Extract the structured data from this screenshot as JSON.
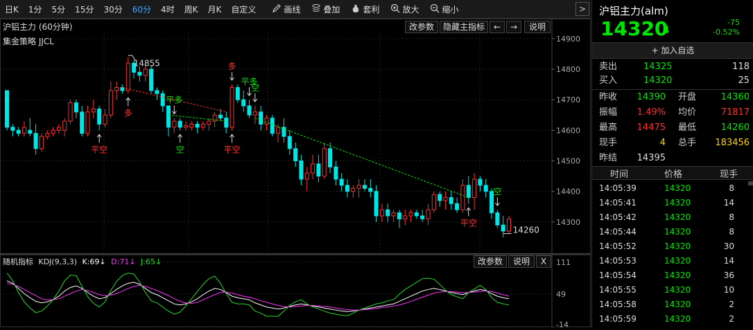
{
  "toolbar": {
    "periods": [
      {
        "label": "日K"
      },
      {
        "label": "1分"
      },
      {
        "label": "5分"
      },
      {
        "label": "15分"
      },
      {
        "label": "30分"
      },
      {
        "label": "60分",
        "active": true
      },
      {
        "label": "4时"
      },
      {
        "label": "周K"
      },
      {
        "label": "月K"
      },
      {
        "label": "自定义"
      }
    ],
    "tools": [
      {
        "label": "画线",
        "icon": "pencil-icon"
      },
      {
        "label": "叠加",
        "icon": "layers-icon"
      },
      {
        "label": "套利",
        "icon": "money-bag-icon"
      },
      {
        "label": "放大",
        "icon": "zoom-in-icon"
      },
      {
        "label": "缩小",
        "icon": "zoom-out-icon"
      }
    ],
    "nav_arrow": ">"
  },
  "main_panel": {
    "title": "沪铝主力 (60分钟)",
    "strategy": "集金策略  JJCL",
    "buttons": {
      "params": "改参数",
      "hide": "隐藏主指标",
      "left": "←",
      "right": "→",
      "help": "说明"
    },
    "y_ticks": [
      14900,
      14800,
      14700,
      14600,
      14500,
      14400,
      14300
    ],
    "high_label": "14855",
    "low_label": "14260"
  },
  "sub_panel": {
    "title": "随机指标",
    "kdj_name": "KDJ(9,3,3)",
    "k": "K:69↓",
    "d": "D:71↓",
    "j": "J:65↓",
    "buttons": {
      "params": "改参数",
      "help": "说明",
      "close": "X"
    },
    "y_ticks": [
      "111",
      "49",
      "-14"
    ]
  },
  "chart_data": {
    "type": "candlestick",
    "ylim": [
      14200,
      14920
    ],
    "y_ticks": [
      14900,
      14800,
      14700,
      14600,
      14500,
      14400,
      14300
    ],
    "candles": [
      [
        14730,
        14730,
        14600,
        14610
      ],
      [
        14610,
        14620,
        14580,
        14600
      ],
      [
        14600,
        14610,
        14580,
        14590
      ],
      [
        14590,
        14630,
        14580,
        14610
      ],
      [
        14600,
        14640,
        14580,
        14590
      ],
      [
        14590,
        14620,
        14520,
        14540
      ],
      [
        14540,
        14590,
        14530,
        14580
      ],
      [
        14580,
        14600,
        14570,
        14590
      ],
      [
        14590,
        14610,
        14580,
        14600
      ],
      [
        14600,
        14620,
        14590,
        14610
      ],
      [
        14600,
        14640,
        14580,
        14630
      ],
      [
        14630,
        14700,
        14620,
        14690
      ],
      [
        14690,
        14700,
        14640,
        14660
      ],
      [
        14660,
        14680,
        14580,
        14590
      ],
      [
        14590,
        14680,
        14580,
        14660
      ],
      [
        14660,
        14700,
        14640,
        14670
      ],
      [
        14670,
        14680,
        14600,
        14620
      ],
      [
        14620,
        14670,
        14610,
        14650
      ],
      [
        14650,
        14760,
        14640,
        14730
      ],
      [
        14730,
        14760,
        14700,
        14740
      ],
      [
        14740,
        14750,
        14720,
        14730
      ],
      [
        14730,
        14840,
        14720,
        14820
      ],
      [
        14820,
        14830,
        14770,
        14790
      ],
      [
        14790,
        14810,
        14760,
        14780
      ],
      [
        14780,
        14820,
        14760,
        14800
      ],
      [
        14800,
        14810,
        14720,
        14730
      ],
      [
        14730,
        14740,
        14700,
        14720
      ],
      [
        14720,
        14730,
        14660,
        14680
      ],
      [
        14680,
        14680,
        14580,
        14610
      ],
      [
        14610,
        14640,
        14590,
        14630
      ],
      [
        14630,
        14640,
        14600,
        14610
      ],
      [
        14610,
        14630,
        14600,
        14615
      ],
      [
        14610,
        14630,
        14600,
        14620
      ],
      [
        14620,
        14630,
        14590,
        14610
      ],
      [
        14610,
        14630,
        14600,
        14620
      ],
      [
        14620,
        14640,
        14600,
        14630
      ],
      [
        14630,
        14660,
        14610,
        14650
      ],
      [
        14650,
        14670,
        14630,
        14640
      ],
      [
        14640,
        14660,
        14590,
        14610
      ],
      [
        14610,
        14750,
        14600,
        14740
      ],
      [
        14740,
        14750,
        14690,
        14700
      ],
      [
        14700,
        14730,
        14660,
        14680
      ],
      [
        14680,
        14700,
        14640,
        14650
      ],
      [
        14650,
        14680,
        14620,
        14660
      ],
      [
        14660,
        14680,
        14600,
        14620
      ],
      [
        14620,
        14650,
        14600,
        14640
      ],
      [
        14640,
        14650,
        14580,
        14590
      ],
      [
        14590,
        14620,
        14560,
        14610
      ],
      [
        14610,
        14640,
        14560,
        14580
      ],
      [
        14580,
        14600,
        14520,
        14540
      ],
      [
        14540,
        14560,
        14480,
        14500
      ],
      [
        14500,
        14520,
        14420,
        14440
      ],
      [
        14440,
        14480,
        14400,
        14460
      ],
      [
        14460,
        14520,
        14440,
        14490
      ],
      [
        14490,
        14520,
        14430,
        14450
      ],
      [
        14450,
        14560,
        14440,
        14540
      ],
      [
        14540,
        14560,
        14460,
        14480
      ],
      [
        14480,
        14500,
        14420,
        14440
      ],
      [
        14440,
        14460,
        14400,
        14420
      ],
      [
        14420,
        14440,
        14380,
        14400
      ],
      [
        14400,
        14420,
        14380,
        14410
      ],
      [
        14410,
        14440,
        14380,
        14420
      ],
      [
        14420,
        14440,
        14400,
        14410
      ],
      [
        14410,
        14440,
        14380,
        14400
      ],
      [
        14400,
        14420,
        14300,
        14320
      ],
      [
        14320,
        14360,
        14300,
        14340
      ],
      [
        14340,
        14360,
        14300,
        14320
      ],
      [
        14320,
        14340,
        14300,
        14330
      ],
      [
        14330,
        14340,
        14280,
        14310
      ],
      [
        14310,
        14340,
        14290,
        14320
      ],
      [
        14320,
        14340,
        14300,
        14330
      ],
      [
        14330,
        14340,
        14310,
        14320
      ],
      [
        14320,
        14340,
        14300,
        14310
      ],
      [
        14310,
        14360,
        14290,
        14340
      ],
      [
        14340,
        14400,
        14330,
        14390
      ],
      [
        14390,
        14400,
        14350,
        14370
      ],
      [
        14370,
        14400,
        14340,
        14380
      ],
      [
        14380,
        14400,
        14340,
        14360
      ],
      [
        14360,
        14380,
        14330,
        14340
      ],
      [
        14340,
        14440,
        14330,
        14420
      ],
      [
        14420,
        14450,
        14360,
        14380
      ],
      [
        14380,
        14460,
        14340,
        14440
      ],
      [
        14440,
        14450,
        14400,
        14420
      ],
      [
        14420,
        14440,
        14380,
        14400
      ],
      [
        14400,
        14410,
        14310,
        14330
      ],
      [
        14330,
        14340,
        14280,
        14290
      ],
      [
        14290,
        14320,
        14250,
        14270
      ],
      [
        14270,
        14320,
        14260,
        14310
      ]
    ],
    "annotations": [
      {
        "text": "平空",
        "i": 16,
        "side": "below",
        "color": "#ff3030"
      },
      {
        "text": "多",
        "i": 21,
        "side": "below",
        "color": "#ff3030"
      },
      {
        "text": "平多",
        "i": 29,
        "side": "above",
        "color": "#00e600"
      },
      {
        "text": "空",
        "i": 30,
        "side": "below",
        "color": "#00e600"
      },
      {
        "text": "平空",
        "i": 39,
        "side": "below",
        "color": "#ff3030"
      },
      {
        "text": "多",
        "i": 39,
        "side": "above",
        "color": "#ff3030"
      },
      {
        "text": "平多",
        "i": 42,
        "side": "above",
        "color": "#00e600"
      },
      {
        "text": "空",
        "i": 43,
        "side": "above",
        "color": "#00e600"
      },
      {
        "text": "平空",
        "i": 80,
        "side": "below",
        "color": "#ff3030"
      },
      {
        "text": "空",
        "i": 85,
        "side": "above",
        "color": "#00e600"
      }
    ],
    "kdj": {
      "ylim": [
        -14,
        111
      ],
      "series": [
        {
          "name": "K",
          "color": "#ffffff",
          "values": [
            75,
            70,
            60,
            50,
            42,
            35,
            32,
            34,
            38,
            45,
            55,
            62,
            65,
            60,
            52,
            45,
            40,
            42,
            50,
            58,
            65,
            70,
            72,
            68,
            60,
            52,
            48,
            42,
            36,
            30,
            28,
            30,
            34,
            40,
            48,
            55,
            60,
            58,
            52,
            45,
            42,
            40,
            38,
            32,
            28,
            24,
            22,
            20,
            22,
            25,
            28,
            30,
            28,
            26,
            24,
            22,
            20,
            18,
            16,
            15,
            16,
            18,
            20,
            22,
            24,
            26,
            28,
            30,
            35,
            40,
            45,
            50,
            55,
            58,
            60,
            58,
            55,
            52,
            50,
            48,
            52,
            55,
            58,
            56,
            50,
            45,
            42,
            40
          ]
        },
        {
          "name": "D",
          "color": "#ff33ff",
          "values": [
            70,
            68,
            64,
            58,
            52,
            46,
            40,
            38,
            38,
            40,
            45,
            50,
            55,
            58,
            56,
            52,
            48,
            46,
            47,
            50,
            55,
            60,
            64,
            66,
            64,
            60,
            56,
            51,
            46,
            40,
            35,
            32,
            31,
            33,
            38,
            43,
            48,
            52,
            53,
            51,
            48,
            45,
            43,
            40,
            36,
            33,
            30,
            27,
            25,
            24,
            25,
            26,
            27,
            27,
            26,
            25,
            24,
            22,
            20,
            19,
            18,
            18,
            19,
            20,
            21,
            23,
            24,
            26,
            28,
            31,
            35,
            39,
            43,
            47,
            51,
            53,
            54,
            54,
            53,
            52,
            52,
            53,
            54,
            55,
            54,
            51,
            48,
            45
          ]
        },
        {
          "name": "J",
          "color": "#22dd22",
          "values": [
            90,
            75,
            52,
            34,
            22,
            13,
            16,
            26,
            38,
            55,
            75,
            86,
            85,
            64,
            44,
            31,
            24,
            34,
            56,
            74,
            85,
            90,
            88,
            72,
            52,
            36,
            32,
            24,
            16,
            10,
            14,
            26,
            40,
            54,
            68,
            79,
            84,
            70,
            50,
            33,
            30,
            30,
            28,
            16,
            12,
            6,
            6,
            6,
            16,
            27,
            34,
            38,
            30,
            24,
            20,
            16,
            12,
            10,
            8,
            7,
            12,
            18,
            22,
            26,
            30,
            32,
            36,
            38,
            49,
            58,
            65,
            72,
            79,
            80,
            78,
            68,
            57,
            48,
            44,
            40,
            52,
            59,
            66,
            58,
            42,
            33,
            30,
            28
          ]
        }
      ]
    }
  },
  "side": {
    "title": "沪铝主力(alm)",
    "price": "14320",
    "change": "-75",
    "change_pct": "-0.52%",
    "add_watch": "+ 加入自选",
    "quote": {
      "sell_label": "卖出",
      "sell_price": "14325",
      "sell_vol": "118",
      "buy_label": "买入",
      "buy_price": "14320",
      "buy_vol": "25"
    },
    "stats": [
      {
        "l1": "昨收",
        "v1": "14390",
        "c1": "green",
        "l2": "开盘",
        "v2": "14360",
        "c2": "green"
      },
      {
        "l1": "振幅",
        "v1": "1.49%",
        "c1": "red",
        "l2": "均价",
        "v2": "71817",
        "c2": "red"
      },
      {
        "l1": "最高",
        "v1": "14475",
        "c1": "red",
        "l2": "最低",
        "v2": "14260",
        "c2": "green"
      },
      {
        "l1": "现手",
        "v1": "4",
        "c1": "yellow",
        "l2": "总手",
        "v2": "183456",
        "c2": "yellow"
      },
      {
        "l1": "昨结",
        "v1": "14395",
        "c1": "white",
        "l2": "",
        "v2": "",
        "c2": "white"
      }
    ],
    "trade_headers": {
      "time": "时间",
      "price": "价格",
      "vol": "现手"
    },
    "trades": [
      {
        "time": "14:05:39",
        "price": "14320",
        "vol": "8"
      },
      {
        "time": "14:05:41",
        "price": "14320",
        "vol": "14"
      },
      {
        "time": "14:05:42",
        "price": "14320",
        "vol": "8"
      },
      {
        "time": "14:05:44",
        "price": "14320",
        "vol": "8"
      },
      {
        "time": "14:05:52",
        "price": "14320",
        "vol": "30"
      },
      {
        "time": "14:05:53",
        "price": "14320",
        "vol": "14"
      },
      {
        "time": "14:05:54",
        "price": "14320",
        "vol": "36"
      },
      {
        "time": "14:05:55",
        "price": "14320",
        "vol": "10"
      },
      {
        "time": "14:05:58",
        "price": "14320",
        "vol": "2"
      },
      {
        "time": "14:05:59",
        "price": "14320",
        "vol": "2"
      }
    ]
  }
}
